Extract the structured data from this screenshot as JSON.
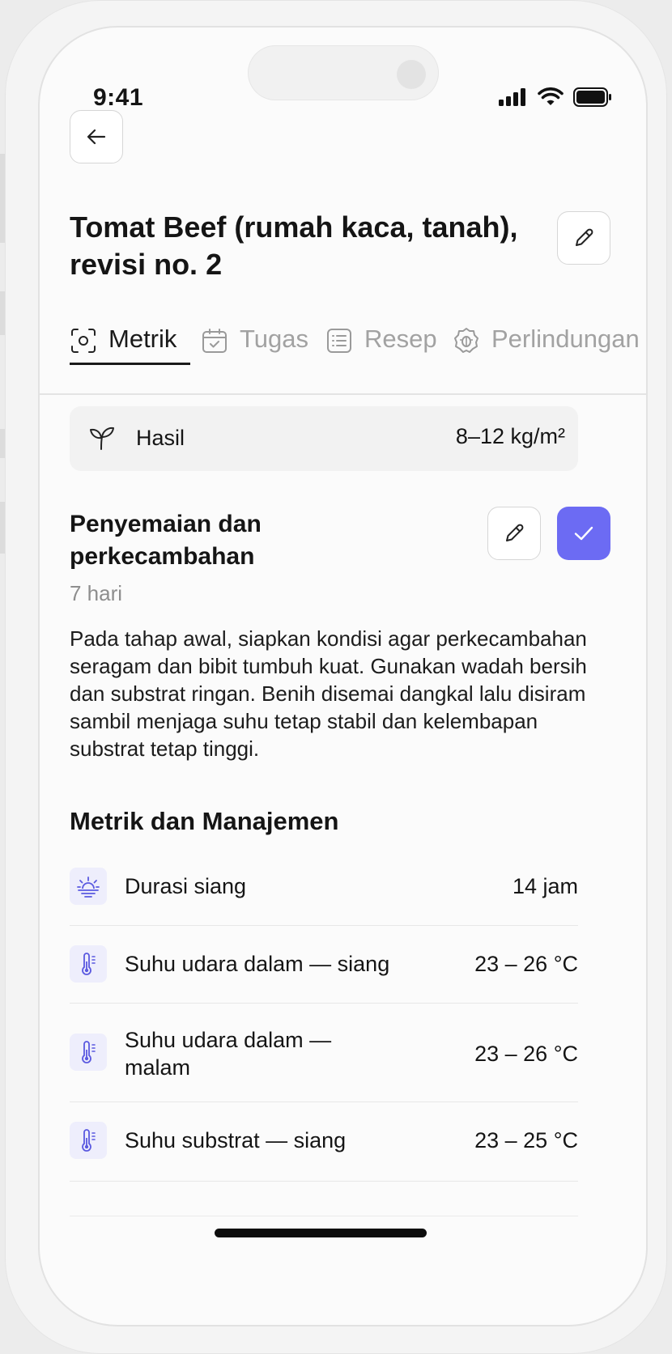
{
  "status_bar": {
    "time": "9:41"
  },
  "header": {
    "title": "Tomat Beef (rumah kaca, tanah), revisi no. 2"
  },
  "tabs": [
    {
      "label": "Metrik",
      "icon": "metrics-icon",
      "active": true
    },
    {
      "label": "Tugas",
      "icon": "calendar-icon",
      "active": false
    },
    {
      "label": "Resep",
      "icon": "list-icon",
      "active": false
    },
    {
      "label": "Perlindungan",
      "icon": "bug-shield-icon",
      "active": false
    }
  ],
  "harvest": {
    "label": "Hasil",
    "value": "8–12 kg/m²",
    "icon": "sprout-icon"
  },
  "stage": {
    "title": "Penyemaian dan perkecambahan",
    "duration": "7 hari",
    "description": "Pada tahap awal, siapkan kondisi agar perkecambahan seragam dan bibit tumbuh kuat. Gunakan wadah bersih dan substrat ringan. Benih disemai dangkal lalu disiram sambil menjaga suhu tetap stabil dan kelembapan substrat tetap tinggi.",
    "completed": true
  },
  "metrics_section": {
    "title": "Metrik dan Manajemen",
    "items": [
      {
        "label": "Durasi siang",
        "value": "14 jam",
        "icon": "sunrise-icon"
      },
      {
        "label": "Suhu udara dalam — siang",
        "value": "23 – 26 °C",
        "icon": "thermometer-icon"
      },
      {
        "label": "Suhu udara dalam — malam",
        "value": "23 – 26 °C",
        "icon": "thermometer-icon"
      },
      {
        "label": "Suhu substrat — siang",
        "value": "23 – 25 °C",
        "icon": "thermometer-icon"
      }
    ]
  },
  "colors": {
    "accent": "#6c6bf3",
    "icon_bg": "#eeeefc",
    "muted_text": "#a2a2a2"
  }
}
